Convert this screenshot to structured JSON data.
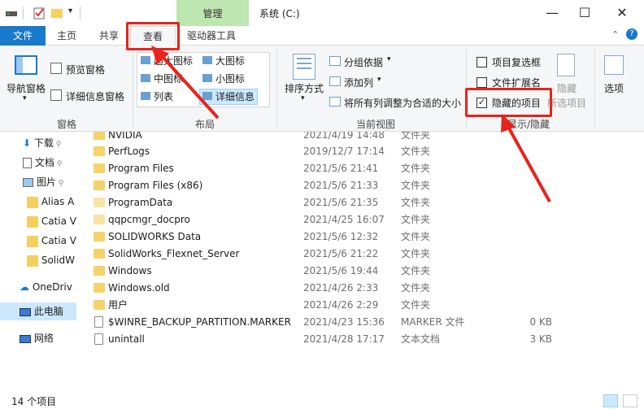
{
  "window": {
    "title": "系统 (C:)",
    "manage_tab": "管理"
  },
  "tabs": [
    {
      "label": "文件"
    },
    {
      "label": "主页"
    },
    {
      "label": "共享"
    },
    {
      "label": "查看"
    },
    {
      "label": "驱动器工具"
    }
  ],
  "ribbon": {
    "panes": {
      "nav_pane": "导航窗格",
      "preview_pane": "预览窗格",
      "details_pane": "详细信息窗格",
      "group": "窗格"
    },
    "layout": {
      "extra_large": "超大图标",
      "large": "大图标",
      "medium": "中图标",
      "small": "小图标",
      "list": "列表",
      "details": "详细信息",
      "group": "布局"
    },
    "current_view": {
      "sort": "排序方式",
      "group_by": "分组依据",
      "add_column": "添加列",
      "fit_columns": "将所有列调整为合适的大小",
      "group": "当前视图"
    },
    "show_hide": {
      "item_checkboxes": "项目复选框",
      "file_extensions": "文件扩展名",
      "hidden_items": "隐藏的项目",
      "hide_selected": "隐藏",
      "hide_selected_2": "所选项目",
      "group": "显示/隐藏",
      "hidden_checked": true,
      "ext_checked": false,
      "cb_checked": false
    },
    "options": {
      "label": "选项"
    }
  },
  "nav": {
    "items": [
      {
        "label": "下载",
        "icon": "download-icon"
      },
      {
        "label": "文档",
        "icon": "document-icon"
      },
      {
        "label": "图片",
        "icon": "picture-icon"
      },
      {
        "label": "Alias A",
        "icon": "folder-icon"
      },
      {
        "label": "Catia V",
        "icon": "folder-icon"
      },
      {
        "label": "Catia V",
        "icon": "folder-icon"
      },
      {
        "label": "SolidW",
        "icon": "folder-icon"
      },
      {
        "label": "OneDriv",
        "icon": "cloud-icon"
      },
      {
        "label": "此电脑",
        "icon": "computer-icon"
      },
      {
        "label": "网络",
        "icon": "network-icon"
      }
    ]
  },
  "files": [
    {
      "name": "NVIDIA",
      "date": "2021/4/19 14:48",
      "type": "文件夹",
      "size": ""
    },
    {
      "name": "PerfLogs",
      "date": "2019/12/7 17:14",
      "type": "文件夹",
      "size": ""
    },
    {
      "name": "Program Files",
      "date": "2021/5/6 21:41",
      "type": "文件夹",
      "size": ""
    },
    {
      "name": "Program Files (x86)",
      "date": "2021/5/6 21:33",
      "type": "文件夹",
      "size": ""
    },
    {
      "name": "ProgramData",
      "date": "2021/5/6 21:35",
      "type": "文件夹",
      "size": ""
    },
    {
      "name": "qqpcmgr_docpro",
      "date": "2021/4/25 16:07",
      "type": "文件夹",
      "size": ""
    },
    {
      "name": "SOLIDWORKS Data",
      "date": "2021/5/6 12:32",
      "type": "文件夹",
      "size": ""
    },
    {
      "name": "SolidWorks_Flexnet_Server",
      "date": "2021/5/6 21:22",
      "type": "文件夹",
      "size": ""
    },
    {
      "name": "Windows",
      "date": "2021/5/6 19:44",
      "type": "文件夹",
      "size": ""
    },
    {
      "name": "Windows.old",
      "date": "2021/4/26 2:33",
      "type": "文件夹",
      "size": ""
    },
    {
      "name": "用户",
      "date": "2021/4/26 2:29",
      "type": "文件夹",
      "size": ""
    },
    {
      "name": "$WINRE_BACKUP_PARTITION.MARKER",
      "date": "2021/4/23 15:36",
      "type": "MARKER 文件",
      "size": "0 KB"
    },
    {
      "name": "unintall",
      "date": "2021/4/28 17:17",
      "type": "文本文档",
      "size": "3 KB"
    }
  ],
  "status": {
    "count": "14 个项目"
  },
  "colors": {
    "accent": "#1979ca",
    "highlight": "#e8231b",
    "manage": "#bde6b0"
  }
}
